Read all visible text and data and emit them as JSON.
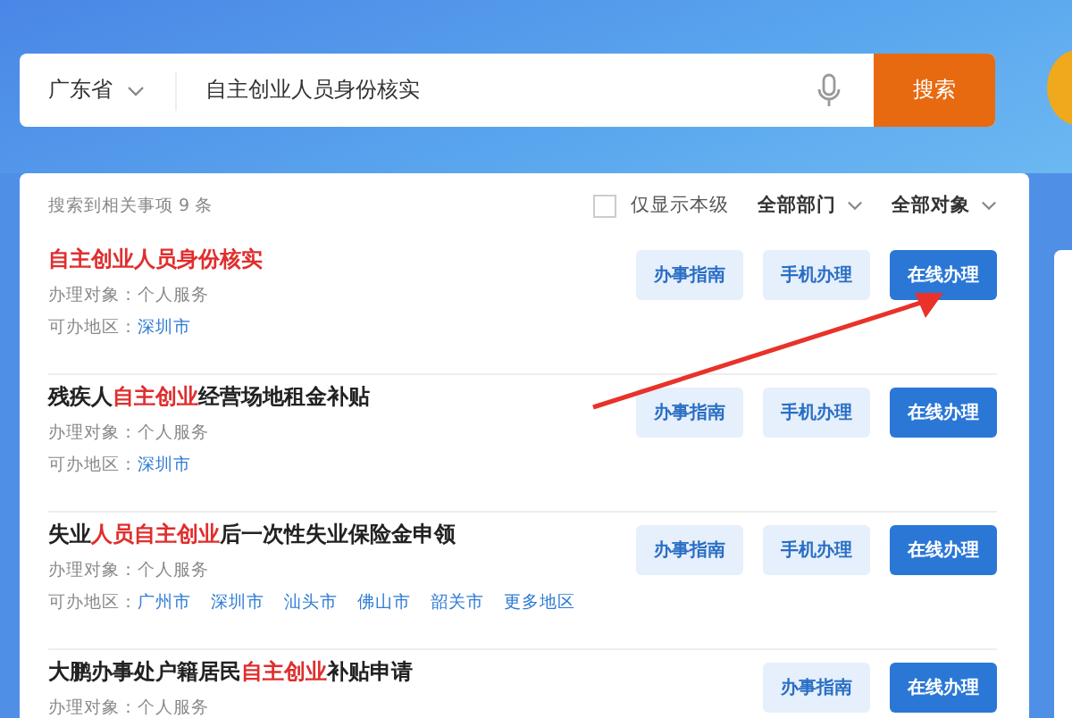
{
  "search": {
    "region": "广东省",
    "query": "自主创业人员身份核实",
    "button": "搜索"
  },
  "results_header": {
    "count_text": "搜索到相关事项 9 条",
    "local_only": {
      "label": "仅显示本级",
      "checked": false
    },
    "filters": [
      "全部部门",
      "全部对象"
    ]
  },
  "results": [
    {
      "title": [
        {
          "text": "自主创业人员身份核实",
          "highlight": true
        }
      ],
      "target_label": "办理对象：",
      "target": "个人服务",
      "region_label": "可办地区：",
      "regions": [
        "深圳市"
      ],
      "buttons": [
        {
          "kind": "guide",
          "label": "办事指南"
        },
        {
          "kind": "mobile",
          "label": "手机办理"
        },
        {
          "kind": "online",
          "label": "在线办理"
        }
      ]
    },
    {
      "title": [
        {
          "text": "残疾人",
          "highlight": false
        },
        {
          "text": "自主创业",
          "highlight": true
        },
        {
          "text": "经营场地租金补贴",
          "highlight": false
        }
      ],
      "target_label": "办理对象：",
      "target": "个人服务",
      "region_label": "可办地区：",
      "regions": [
        "深圳市"
      ],
      "buttons": [
        {
          "kind": "guide",
          "label": "办事指南"
        },
        {
          "kind": "mobile",
          "label": "手机办理"
        },
        {
          "kind": "online",
          "label": "在线办理"
        }
      ]
    },
    {
      "title": [
        {
          "text": "失业",
          "highlight": false
        },
        {
          "text": "人员自主创业",
          "highlight": true
        },
        {
          "text": "后一次性失业保险金申领",
          "highlight": false
        }
      ],
      "target_label": "办理对象：",
      "target": "个人服务",
      "region_label": "可办地区：",
      "regions": [
        "广州市",
        "深圳市",
        "汕头市",
        "佛山市",
        "韶关市",
        "更多地区"
      ],
      "buttons": [
        {
          "kind": "guide",
          "label": "办事指南"
        },
        {
          "kind": "mobile",
          "label": "手机办理"
        },
        {
          "kind": "online",
          "label": "在线办理"
        }
      ]
    },
    {
      "title": [
        {
          "text": "大鹏办事处户籍居民",
          "highlight": false
        },
        {
          "text": "自主创业",
          "highlight": true
        },
        {
          "text": "补贴申请",
          "highlight": false
        }
      ],
      "target_label": "办理对象：",
      "target": "个人服务",
      "buttons": [
        {
          "kind": "guide",
          "label": "办事指南"
        },
        {
          "kind": "online",
          "label": "在线办理"
        }
      ]
    }
  ]
}
